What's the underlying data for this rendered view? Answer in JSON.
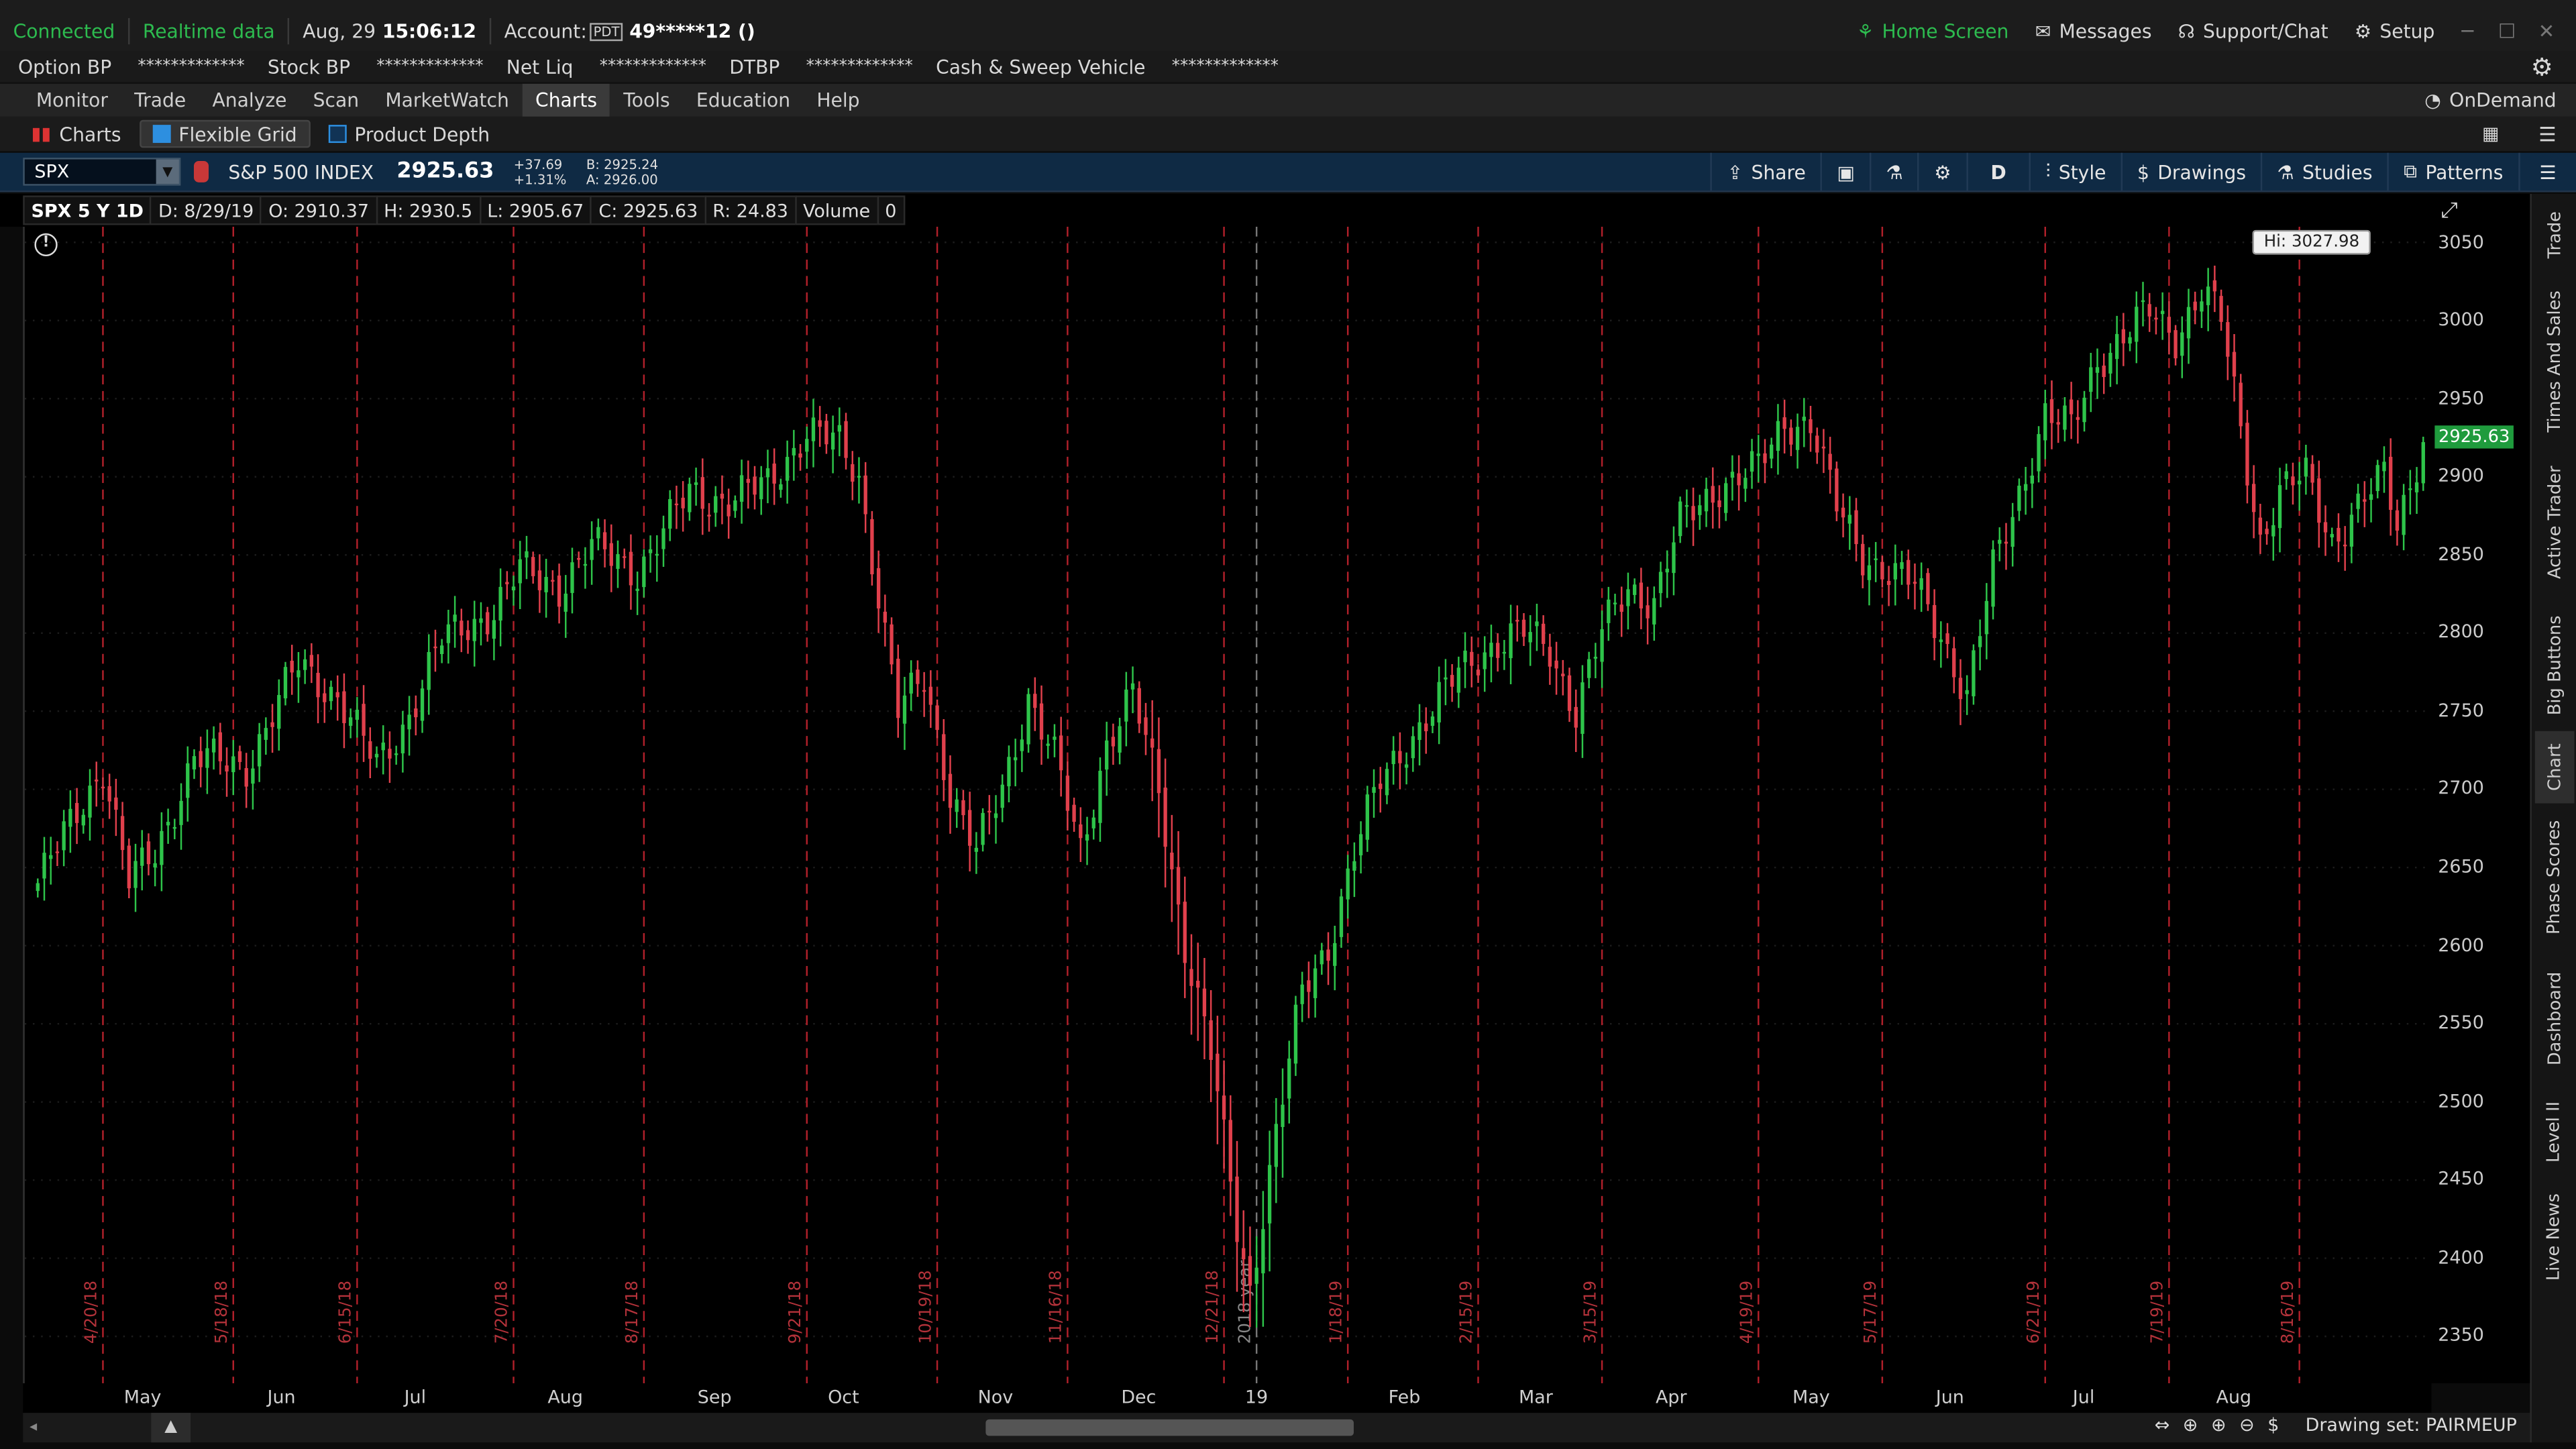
{
  "topbar": {
    "connection": "Connected",
    "data_mode": "Realtime data",
    "date": "Aug, 29",
    "time": "15:06:12",
    "account_label": "Account:",
    "account_badge": "PDT",
    "account_number": "49*****12 ()",
    "home_screen": "Home Screen",
    "messages": "Messages",
    "support": "Support/Chat",
    "setup": "Setup"
  },
  "balances": [
    {
      "label": "Option BP",
      "value": "*************"
    },
    {
      "label": "Stock BP",
      "value": "*************"
    },
    {
      "label": "Net Liq",
      "value": "*************"
    },
    {
      "label": "DTBP",
      "value": "*************"
    },
    {
      "label": "Cash & Sweep Vehicle",
      "value": "*************"
    }
  ],
  "main_tabs": [
    "Monitor",
    "Trade",
    "Analyze",
    "Scan",
    "MarketWatch",
    "Charts",
    "Tools",
    "Education",
    "Help"
  ],
  "active_main_tab": "Charts",
  "ondemand": "OnDemand",
  "sub_tabs": [
    "Charts",
    "Flexible Grid",
    "Product Depth"
  ],
  "symbol_bar": {
    "symbol": "SPX",
    "name": "S&P 500 INDEX",
    "last": "2925.63",
    "change": "+37.69",
    "change_pct": "+1.31%",
    "bid": "B: 2925.24",
    "ask": "A: 2926.00",
    "share": "Share",
    "aggregation": "D",
    "style": "Style",
    "drawings": "Drawings",
    "studies": "Studies",
    "patterns": "Patterns"
  },
  "ohlc_bar": {
    "title": "SPX 5 Y 1D",
    "date": "D: 8/29/19",
    "open": "O: 2910.37",
    "high": "H: 2930.5",
    "low": "L: 2905.67",
    "close": "C: 2925.63",
    "range": "R: 24.83",
    "volume_label": "Volume",
    "volume_value": "0"
  },
  "chart_data": {
    "type": "candlestick",
    "y_ticks": [
      3050,
      3000,
      2950,
      2900,
      2850,
      2800,
      2750,
      2700,
      2650,
      2600,
      2550,
      2500,
      2450,
      2400,
      2350
    ],
    "ylim": [
      2320,
      3060
    ],
    "x_month_labels": [
      {
        "label": "May",
        "i": 16
      },
      {
        "label": "Jun",
        "i": 38
      },
      {
        "label": "Jul",
        "i": 59
      },
      {
        "label": "Aug",
        "i": 81
      },
      {
        "label": "Sep",
        "i": 104
      },
      {
        "label": "Oct",
        "i": 124
      },
      {
        "label": "Nov",
        "i": 147
      },
      {
        "label": "Dec",
        "i": 169
      },
      {
        "label": "19",
        "i": 188
      },
      {
        "label": "Feb",
        "i": 210
      },
      {
        "label": "Mar",
        "i": 230
      },
      {
        "label": "Apr",
        "i": 251
      },
      {
        "label": "May",
        "i": 272
      },
      {
        "label": "Jun",
        "i": 294
      },
      {
        "label": "Jul",
        "i": 315
      },
      {
        "label": "Aug",
        "i": 337
      }
    ],
    "expiry_markers": [
      {
        "label": "4/20/18",
        "i": 10
      },
      {
        "label": "5/18/18",
        "i": 30
      },
      {
        "label": "6/15/18",
        "i": 49
      },
      {
        "label": "7/20/18",
        "i": 73
      },
      {
        "label": "8/17/18",
        "i": 93
      },
      {
        "label": "9/21/18",
        "i": 118
      },
      {
        "label": "10/19/18",
        "i": 138
      },
      {
        "label": "11/16/18",
        "i": 158
      },
      {
        "label": "12/21/18",
        "i": 182
      },
      {
        "label": "1/18/19",
        "i": 201
      },
      {
        "label": "2/15/19",
        "i": 221
      },
      {
        "label": "3/15/19",
        "i": 240
      },
      {
        "label": "4/19/19",
        "i": 264
      },
      {
        "label": "5/17/19",
        "i": 283
      },
      {
        "label": "6/21/19",
        "i": 308
      },
      {
        "label": "7/19/19",
        "i": 327
      },
      {
        "label": "8/16/19",
        "i": 347
      }
    ],
    "year_marker": {
      "label": "2018 year",
      "i": 187
    },
    "hi_label": "Hi: 3027.98",
    "last_price_tag": "2925.63",
    "key_closes": [
      {
        "i": 0,
        "v": 2640
      },
      {
        "i": 10,
        "v": 2715
      },
      {
        "i": 14,
        "v": 2640
      },
      {
        "i": 18,
        "v": 2660
      },
      {
        "i": 24,
        "v": 2720
      },
      {
        "i": 32,
        "v": 2715
      },
      {
        "i": 40,
        "v": 2780
      },
      {
        "i": 46,
        "v": 2760
      },
      {
        "i": 52,
        "v": 2715
      },
      {
        "i": 56,
        "v": 2740
      },
      {
        "i": 62,
        "v": 2795
      },
      {
        "i": 70,
        "v": 2815
      },
      {
        "i": 74,
        "v": 2840
      },
      {
        "i": 80,
        "v": 2830
      },
      {
        "i": 85,
        "v": 2855
      },
      {
        "i": 92,
        "v": 2840
      },
      {
        "i": 100,
        "v": 2890
      },
      {
        "i": 106,
        "v": 2885
      },
      {
        "i": 112,
        "v": 2895
      },
      {
        "i": 118,
        "v": 2930
      },
      {
        "i": 123,
        "v": 2920
      },
      {
        "i": 126,
        "v": 2900
      },
      {
        "i": 132,
        "v": 2750
      },
      {
        "i": 136,
        "v": 2770
      },
      {
        "i": 140,
        "v": 2700
      },
      {
        "i": 144,
        "v": 2660
      },
      {
        "i": 148,
        "v": 2700
      },
      {
        "i": 152,
        "v": 2760
      },
      {
        "i": 156,
        "v": 2720
      },
      {
        "i": 160,
        "v": 2660
      },
      {
        "i": 164,
        "v": 2730
      },
      {
        "i": 168,
        "v": 2760
      },
      {
        "i": 172,
        "v": 2700
      },
      {
        "i": 176,
        "v": 2600
      },
      {
        "i": 180,
        "v": 2530
      },
      {
        "i": 184,
        "v": 2420
      },
      {
        "i": 186,
        "v": 2380
      },
      {
        "i": 190,
        "v": 2480
      },
      {
        "i": 194,
        "v": 2570
      },
      {
        "i": 198,
        "v": 2600
      },
      {
        "i": 202,
        "v": 2660
      },
      {
        "i": 206,
        "v": 2705
      },
      {
        "i": 210,
        "v": 2730
      },
      {
        "i": 214,
        "v": 2750
      },
      {
        "i": 218,
        "v": 2775
      },
      {
        "i": 222,
        "v": 2790
      },
      {
        "i": 228,
        "v": 2800
      },
      {
        "i": 232,
        "v": 2790
      },
      {
        "i": 236,
        "v": 2750
      },
      {
        "i": 240,
        "v": 2800
      },
      {
        "i": 244,
        "v": 2830
      },
      {
        "i": 248,
        "v": 2820
      },
      {
        "i": 252,
        "v": 2870
      },
      {
        "i": 258,
        "v": 2895
      },
      {
        "i": 264,
        "v": 2905
      },
      {
        "i": 268,
        "v": 2935
      },
      {
        "i": 272,
        "v": 2935
      },
      {
        "i": 276,
        "v": 2880
      },
      {
        "i": 280,
        "v": 2850
      },
      {
        "i": 284,
        "v": 2840
      },
      {
        "i": 288,
        "v": 2830
      },
      {
        "i": 292,
        "v": 2800
      },
      {
        "i": 296,
        "v": 2760
      },
      {
        "i": 300,
        "v": 2840
      },
      {
        "i": 304,
        "v": 2890
      },
      {
        "i": 308,
        "v": 2940
      },
      {
        "i": 312,
        "v": 2930
      },
      {
        "i": 316,
        "v": 2975
      },
      {
        "i": 320,
        "v": 2990
      },
      {
        "i": 324,
        "v": 3005
      },
      {
        "i": 328,
        "v": 2990
      },
      {
        "i": 332,
        "v": 3020
      },
      {
        "i": 335,
        "v": 3000
      },
      {
        "i": 338,
        "v": 2930
      },
      {
        "i": 341,
        "v": 2860
      },
      {
        "i": 344,
        "v": 2890
      },
      {
        "i": 348,
        "v": 2900
      },
      {
        "i": 352,
        "v": 2860
      },
      {
        "i": 356,
        "v": 2880
      },
      {
        "i": 360,
        "v": 2900
      },
      {
        "i": 362,
        "v": 2870
      },
      {
        "i": 366,
        "v": 2925
      }
    ],
    "bar_count": 367
  },
  "bottombar": {
    "drawing_set": "Drawing set: PAIRMEUP"
  },
  "right_rail": [
    "Trade",
    "Times And Sales",
    "Active Trader",
    "Big Buttons",
    "Chart",
    "Phase Scores",
    "Dashboard",
    "Level II",
    "Live News"
  ],
  "active_rail": "Chart",
  "colors": {
    "up": "#2ec44a",
    "down": "#e0404c",
    "marker": "#b0202a",
    "bg": "#000000",
    "toolbar_blue": "#0f2a44"
  }
}
